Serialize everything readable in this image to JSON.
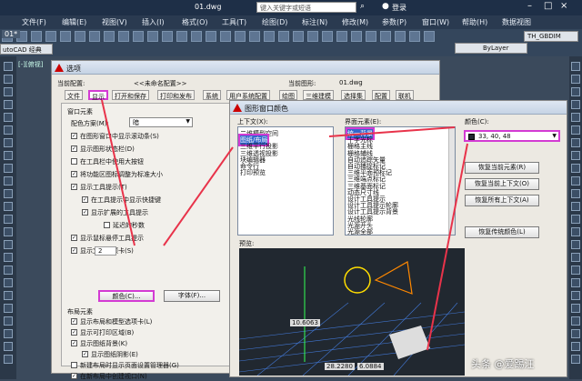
{
  "app": {
    "file_tab": "01.dwg",
    "search_placeholder": "键入关键字或短语",
    "login": "登录",
    "dropdown_bylayer": "ByLayer",
    "std_combo": "TH_GBDIM",
    "workspace": "utoCAD 经典",
    "drawing_tab": "01*",
    "left_label": "[-][俯视]"
  },
  "menu": [
    "文件(F)",
    "编辑(E)",
    "视图(V)",
    "插入(I)",
    "格式(O)",
    "工具(T)",
    "绘图(D)",
    "标注(N)",
    "修改(M)",
    "参数(P)",
    "窗口(W)",
    "帮助(H)",
    "数据视图"
  ],
  "options": {
    "title": "选项",
    "current_profile_label": "当前配置:",
    "current_profile_value": "<<未命名配置>>",
    "current_drawing_label": "当前图形:",
    "current_drawing_value": "01.dwg",
    "tabs": [
      "文件",
      "显示",
      "打开和保存",
      "打印和发布",
      "系统",
      "用户系统配置",
      "绘图",
      "三维建模",
      "选择集",
      "配置",
      "联机"
    ],
    "window_elements": "窗口元素",
    "color_scheme_label": "配色方案(M):",
    "color_scheme_value": "暗",
    "checks": [
      {
        "text": "在图形窗口中显示滚动条(S)",
        "on": true
      },
      {
        "text": "显示图形状态栏(D)",
        "on": true
      },
      {
        "text": "在工具栏中使用大按钮",
        "on": false
      },
      {
        "text": "将功能区图标调整为标准大小",
        "on": true
      },
      {
        "text": "显示工具提示(T)",
        "on": true
      },
      {
        "text": "在工具提示中显示快捷键",
        "on": true
      },
      {
        "text": "显示扩展的工具提示",
        "on": true
      },
      {
        "text": "延迟的秒数",
        "on": false
      },
      {
        "text": "显示鼠标悬停工具提示",
        "on": true
      },
      {
        "text": "显示文件选项卡(S)",
        "on": true
      }
    ],
    "delay_value": "2",
    "colors_button": "颜色(C)...",
    "fonts_button": "字体(F)...",
    "layout_elements": "布局元素",
    "layout_checks": [
      {
        "text": "显示布局和模型选项卡(L)",
        "on": true
      },
      {
        "text": "显示可打印区域(B)",
        "on": true
      },
      {
        "text": "显示图纸背景(K)",
        "on": true
      },
      {
        "text": "显示图纸阴影(E)",
        "on": true
      },
      {
        "text": "新建布局时显示页面设置管理器(G)",
        "on": false
      },
      {
        "text": "在新布局中创建视口(N)",
        "on": true
      }
    ]
  },
  "colorsdlg": {
    "title": "图形窗口颜色",
    "context_label": "上下文(X):",
    "contexts": [
      "二维模型空间",
      "图纸/布局",
      "三维平行投影",
      "三维透视投影",
      "块编辑器",
      "命令行",
      "打印预览"
    ],
    "element_label": "界面元素(E):",
    "elements": [
      "统一背景",
      "十字光标",
      "栅格主线",
      "栅格辅线",
      "自动追踪矢量",
      "自动捕捉标记",
      "三维平面预标记",
      "三维端点标记",
      "三维基面标记",
      "动态尺寸线",
      "设计工具提示",
      "设计工具提示轮廓",
      "设计工具提示背景",
      "光线轮廓",
      "光源开头",
      "光源全部",
      "光源衰减"
    ],
    "color_label": "颜色(C):",
    "color_value": "33, 40, 48",
    "color_hex": "#212830",
    "restore_element": "恢复当前元素(R)",
    "restore_context": "恢复当前上下文(O)",
    "restore_all": "恢复所有上下文(A)",
    "restore_classic": "恢复传统颜色(L)",
    "preview_label": "预览:",
    "dim1": "10.6063",
    "dim2": "28.2280",
    "dim3": "6.0884"
  },
  "watermark": "头条 @爱踢汪"
}
